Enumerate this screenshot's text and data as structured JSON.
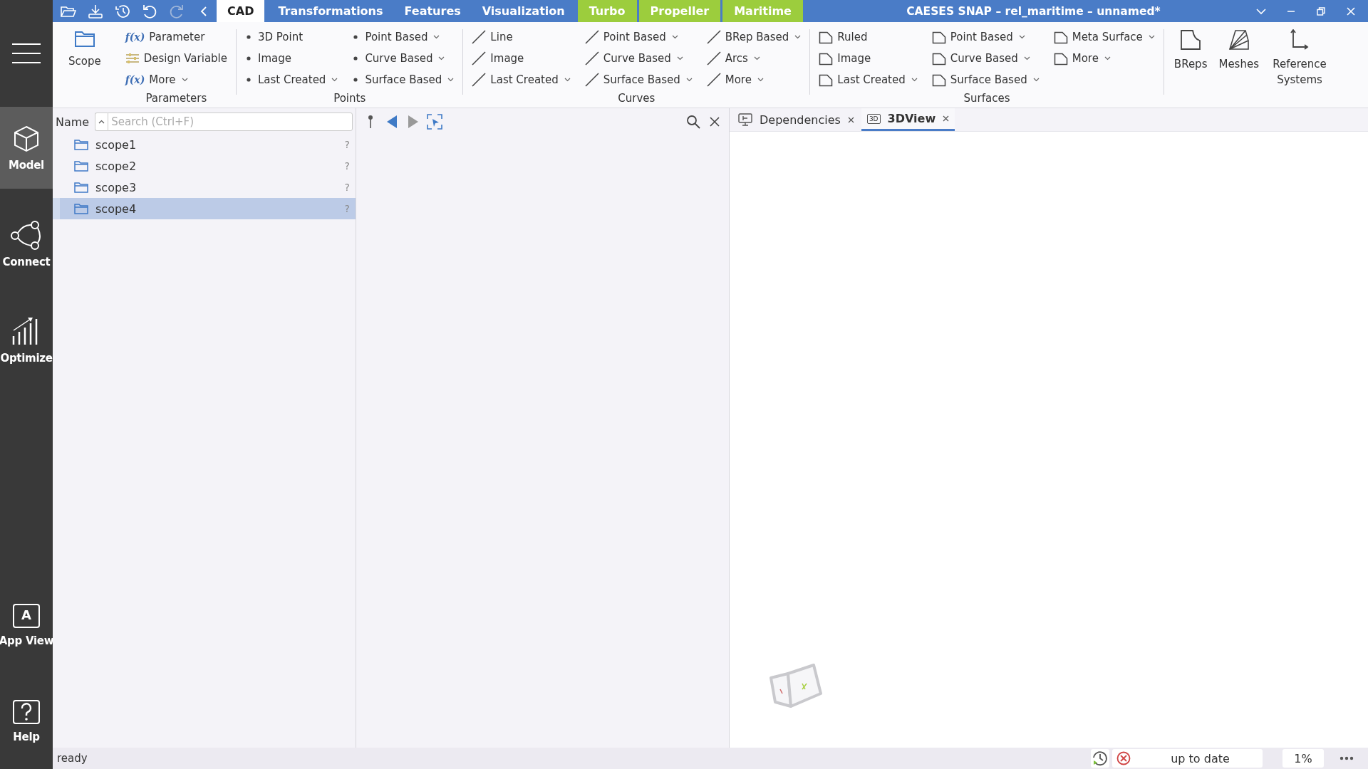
{
  "window": {
    "title": "CAESES SNAP – rel_maritime – unnamed*"
  },
  "tabs": [
    {
      "label": "CAD",
      "selected": true,
      "kind": "standard"
    },
    {
      "label": "Transformations",
      "selected": false,
      "kind": "standard"
    },
    {
      "label": "Features",
      "selected": false,
      "kind": "standard"
    },
    {
      "label": "Visualization",
      "selected": false,
      "kind": "standard"
    },
    {
      "label": "Turbo",
      "selected": false,
      "kind": "plugin"
    },
    {
      "label": "Propeller",
      "selected": false,
      "kind": "plugin"
    },
    {
      "label": "Maritime",
      "selected": false,
      "kind": "plugin"
    }
  ],
  "sidebar": {
    "items": [
      {
        "label": "Model",
        "selected": true,
        "kind": "cube"
      },
      {
        "label": "Connect",
        "selected": false,
        "kind": "nodes"
      },
      {
        "label": "Optimize",
        "selected": false,
        "kind": "chart"
      },
      {
        "label": "App View",
        "selected": false,
        "kind": "app",
        "icon_text": "A"
      },
      {
        "label": "Help",
        "selected": false,
        "kind": "help"
      }
    ]
  },
  "ribbon": {
    "groups": [
      {
        "columns": [
          [
            {
              "kind": "folder",
              "label": "Scope",
              "dropdown": false
            }
          ]
        ]
      },
      {
        "title": "Parameters",
        "columns": [
          [
            {
              "kind": "function",
              "icon_text": "f(x)",
              "label": "Parameter",
              "dropdown": false
            },
            {
              "kind": "sliders",
              "label": "Design Variable",
              "dropdown": false
            },
            {
              "kind": "function",
              "icon_text": "f(x)",
              "label": "More",
              "dropdown": true
            }
          ]
        ]
      },
      {
        "title": "Points",
        "columns": [
          [
            {
              "kind": "point",
              "label": "3D Point",
              "dropdown": false
            },
            {
              "kind": "point",
              "label": "Image",
              "dropdown": false
            },
            {
              "kind": "point",
              "label": "Last Created",
              "dropdown": true
            }
          ],
          [
            {
              "kind": "point",
              "label": "Point Based",
              "dropdown": true
            },
            {
              "kind": "point",
              "label": "Curve Based",
              "dropdown": true
            },
            {
              "kind": "point",
              "label": "Surface Based",
              "dropdown": true
            }
          ]
        ]
      },
      {
        "title": "Curves",
        "columns": [
          [
            {
              "kind": "curve",
              "label": "Line",
              "dropdown": false
            },
            {
              "kind": "curve",
              "label": "Image",
              "dropdown": false
            },
            {
              "kind": "curve",
              "label": "Last Created",
              "dropdown": true
            }
          ],
          [
            {
              "kind": "curve",
              "label": "Point Based",
              "dropdown": true
            },
            {
              "kind": "curve",
              "label": "Curve Based",
              "dropdown": true
            },
            {
              "kind": "curve",
              "label": "Surface Based",
              "dropdown": true
            }
          ],
          [
            {
              "kind": "curve",
              "label": "BRep Based",
              "dropdown": true
            },
            {
              "kind": "curve",
              "label": "Arcs",
              "dropdown": true
            },
            {
              "kind": "curve",
              "label": "More",
              "dropdown": true
            }
          ]
        ]
      },
      {
        "title": "Surfaces",
        "columns": [
          [
            {
              "kind": "surface",
              "label": "Ruled",
              "dropdown": false
            },
            {
              "kind": "surface",
              "label": "Image",
              "dropdown": false
            },
            {
              "kind": "surface",
              "label": "Last Created",
              "dropdown": true
            }
          ],
          [
            {
              "kind": "surface",
              "label": "Point Based",
              "dropdown": true
            },
            {
              "kind": "surface",
              "label": "Curve Based",
              "dropdown": true
            },
            {
              "kind": "surface",
              "label": "Surface Based",
              "dropdown": true
            }
          ],
          [
            {
              "kind": "surface",
              "label": "Meta Surface",
              "dropdown": true
            },
            {
              "kind": "surface",
              "label": "More",
              "dropdown": true
            }
          ]
        ]
      },
      {
        "columns": [
          [
            {
              "kind": "brep",
              "label": "BReps",
              "dropdown": false
            }
          ],
          [
            {
              "kind": "mesh",
              "label": "Meshes",
              "dropdown": false
            }
          ],
          [
            {
              "kind": "axes",
              "label": "Reference Systems",
              "dropdown": false
            }
          ]
        ]
      }
    ]
  },
  "tree": {
    "header": "Name",
    "search": {
      "placeholder": "Search (Ctrl+F)"
    },
    "rows": [
      {
        "label": "scope1",
        "mark": "?",
        "selected": false
      },
      {
        "label": "scope2",
        "mark": "?",
        "selected": false
      },
      {
        "label": "scope3",
        "mark": "?",
        "selected": false
      },
      {
        "label": "scope4",
        "mark": "?",
        "selected": true
      }
    ]
  },
  "view_tabs": [
    {
      "label": "Dependencies",
      "selected": false,
      "kind": "graph"
    },
    {
      "label": "3DView",
      "selected": true,
      "kind": "view3d",
      "badge": "3D"
    }
  ],
  "status_bar": {
    "message": "ready",
    "state": "up to date",
    "progress": "1%"
  }
}
